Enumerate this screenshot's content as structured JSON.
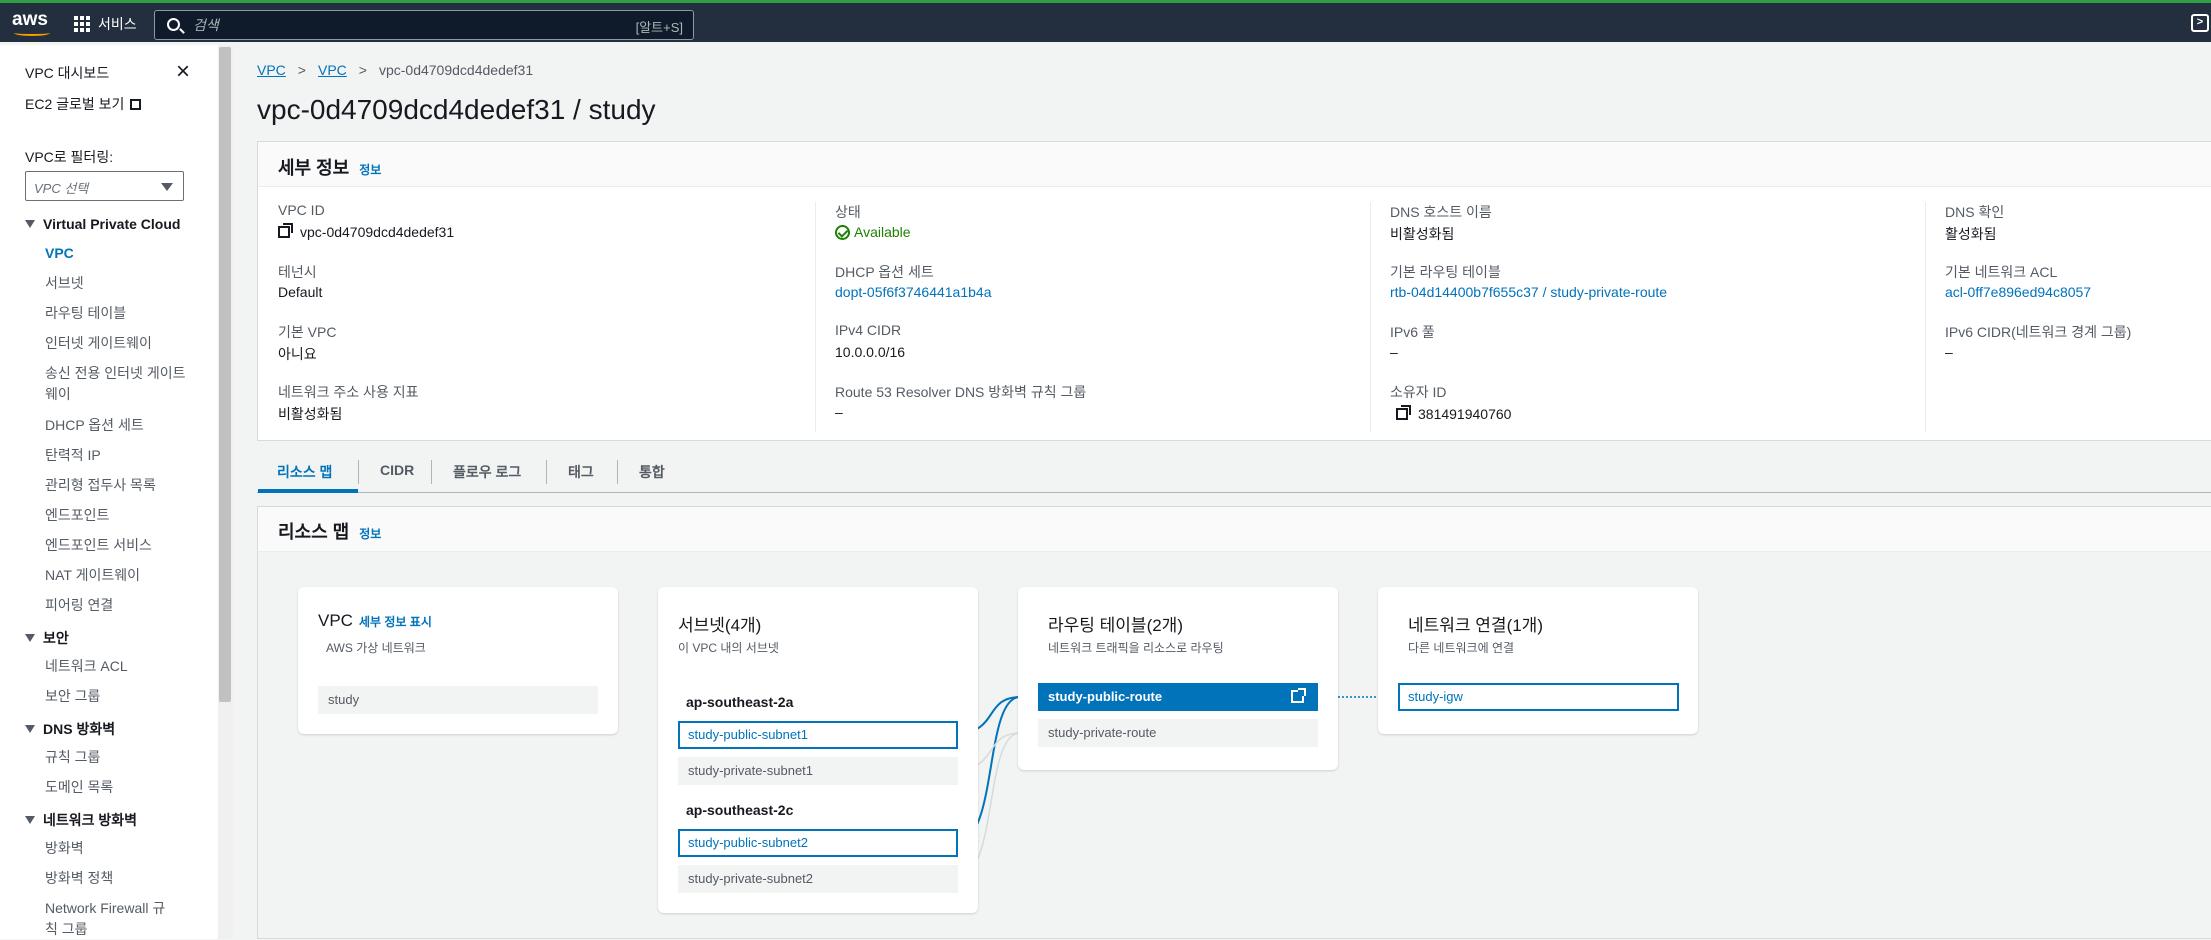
{
  "nav": {
    "services_label": "서비스",
    "search_placeholder": "검색",
    "search_shortcut": "[알트+S]"
  },
  "sidebar": {
    "top_links": [
      "VPC 대시보드",
      "EC2 글로벌 보기"
    ],
    "filter_label": "VPC로 필터링:",
    "filter_select": "VPC 선택",
    "sections": [
      {
        "title": "Virtual Private Cloud",
        "items": [
          "VPC",
          "서브넷",
          "라우팅 테이블",
          "인터넷 게이트웨이",
          "송신 전용 인터넷 게이트웨이",
          "DHCP 옵션 세트",
          "탄력적 IP",
          "관리형 접두사 목록",
          "엔드포인트",
          "엔드포인트 서비스",
          "NAT 게이트웨이",
          "피어링 연결"
        ]
      },
      {
        "title": "보안",
        "items": [
          "네트워크 ACL",
          "보안 그룹"
        ]
      },
      {
        "title": "DNS 방화벽",
        "items": [
          "규칙 그룹",
          "도메인 목록"
        ]
      },
      {
        "title": "네트워크 방화벽",
        "items": [
          "방화벽",
          "방화벽 정책",
          "Network Firewall 규칙 그룹"
        ]
      }
    ]
  },
  "breadcrumb": {
    "items": [
      "VPC",
      "VPC"
    ],
    "current": "vpc-0d4709dcd4dedef31"
  },
  "page_title": "vpc-0d4709dcd4dedef31 / study",
  "details": {
    "title": "세부 정보",
    "info": "정보",
    "col1": [
      {
        "label": "VPC ID",
        "value": "vpc-0d4709dcd4dedef31"
      },
      {
        "label": "테넌시",
        "value": "Default"
      },
      {
        "label": "기본 VPC",
        "value": "아니요"
      },
      {
        "label": "네트워크 주소 사용 지표",
        "value": "비활성화됨"
      }
    ],
    "col2": [
      {
        "label": "상태",
        "value": "Available"
      },
      {
        "label": "DHCP 옵션 세트",
        "value": "dopt-05f6f3746441a1b4a"
      },
      {
        "label": "IPv4 CIDR",
        "value": "10.0.0.0/16"
      },
      {
        "label": "Route 53 Resolver DNS 방화벽 규칙 그룹",
        "value": "–"
      }
    ],
    "col3": [
      {
        "label": "DNS 호스트 이름",
        "value": "비활성화됨"
      },
      {
        "label": "기본 라우팅 테이블",
        "value": "rtb-04d14400b7f655c37 / study-private-route"
      },
      {
        "label": "IPv6 풀",
        "value": "–"
      },
      {
        "label": "소유자 ID",
        "value": "381491940760"
      }
    ],
    "col4": [
      {
        "label": "DNS 확인",
        "value": "활성화됨"
      },
      {
        "label": "기본 네트워크 ACL",
        "value": "acl-0ff7e896ed94c8057"
      },
      {
        "label": "IPv6 CIDR(네트워크 경계 그룹)",
        "value": "–"
      }
    ]
  },
  "tabs": [
    "리소스 맵",
    "CIDR",
    "플로우 로그",
    "태그",
    "통합"
  ],
  "resource_map": {
    "title": "리소스 맵",
    "info": "정보",
    "vpc": {
      "title": "VPC",
      "link": "세부 정보 표시",
      "subtitle": "AWS 가상 네트워크",
      "items": [
        "study"
      ]
    },
    "subnets": {
      "title": "서브넷(4개)",
      "subtitle": "이 VPC 내의 서브넷",
      "azs": [
        {
          "name": "ap-southeast-2a",
          "items": [
            "study-public-subnet1",
            "study-private-subnet1"
          ]
        },
        {
          "name": "ap-southeast-2c",
          "items": [
            "study-public-subnet2",
            "study-private-subnet2"
          ]
        }
      ]
    },
    "route_tables": {
      "title": "라우팅 테이블(2개)",
      "subtitle": "네트워크 트래픽을 리소스로 라우팅",
      "items": [
        "study-public-route",
        "study-private-route"
      ]
    },
    "network": {
      "title": "네트워크 연결(1개)",
      "subtitle": "다른 네트워크에 연결",
      "items": [
        "study-igw"
      ]
    }
  },
  "colors": {
    "accent": "#0073bb",
    "nav_bg": "#232f3e",
    "success": "#1d8102"
  }
}
